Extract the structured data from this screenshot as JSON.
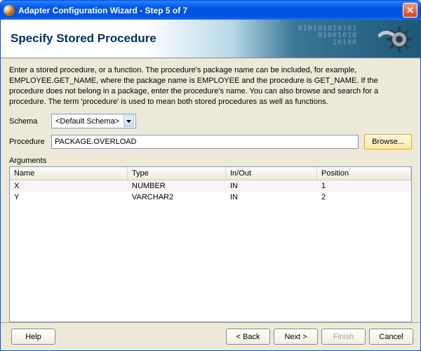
{
  "titlebar": {
    "title": "Adapter Configuration Wizard - Step 5 of 7"
  },
  "banner": {
    "heading": "Specify Stored Procedure"
  },
  "intro": "Enter a stored procedure, or a function. The procedure's package name can be included, for example, EMPLOYEE.GET_NAME, where the package name is EMPLOYEE and the procedure is GET_NAME.  If the procedure does not belong in a package, enter the procedure's name. You can also browse and search for a procedure. The term 'procedure' is used to mean both stored procedures as well as functions.",
  "labels": {
    "schema": "Schema",
    "procedure": "Procedure",
    "arguments": "Arguments",
    "browse": "Browse..."
  },
  "schemaSelect": "<Default Schema>",
  "procedureValue": "PACKAGE.OVERLOAD",
  "columns": {
    "name": "Name",
    "type": "Type",
    "inout": "In/Out",
    "position": "Position"
  },
  "rows": [
    {
      "name": "X",
      "type": "NUMBER",
      "inout": "IN",
      "position": "1"
    },
    {
      "name": "Y",
      "type": "VARCHAR2",
      "inout": "IN",
      "position": "2"
    }
  ],
  "footer": {
    "help": "Help",
    "back": "< Back",
    "next": "Next >",
    "finish": "Finish",
    "cancel": "Cancel"
  }
}
